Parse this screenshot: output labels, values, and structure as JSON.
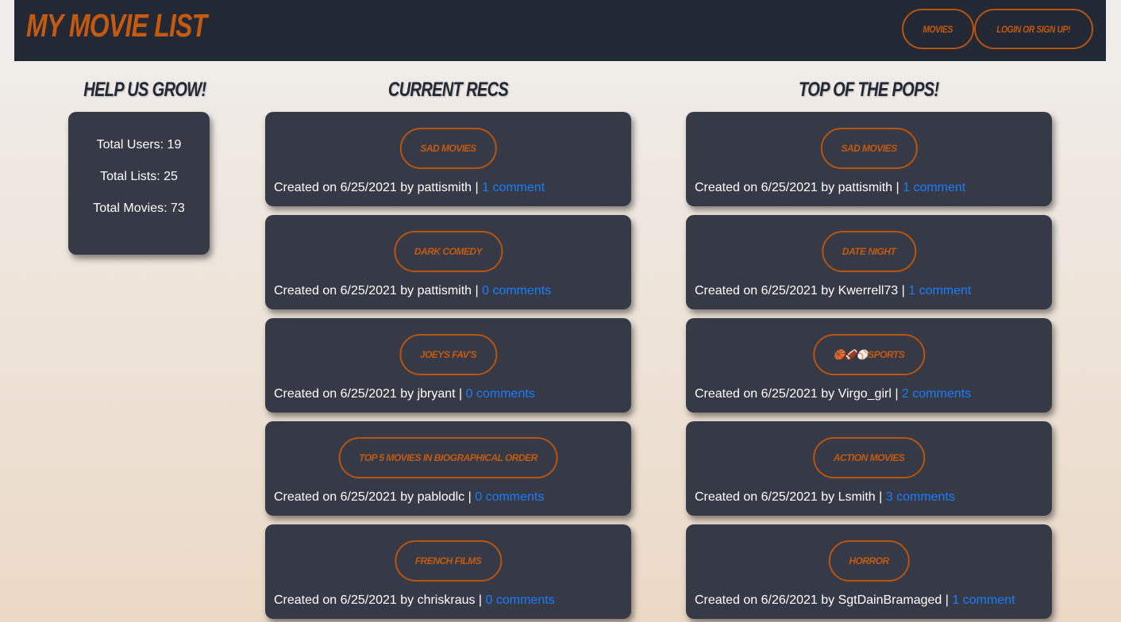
{
  "navbar": {
    "brand": "My Movie List",
    "buttons": [
      {
        "label": "Movies"
      },
      {
        "label": "Login or Sign Up!"
      }
    ]
  },
  "stats": {
    "heading": "Help Us Grow!",
    "lines": [
      "Total Users: 19",
      "Total Lists: 25",
      "Total Movies: 73"
    ]
  },
  "current_recs": {
    "heading": "Current Recs",
    "lists": [
      {
        "title": "Sad Movies",
        "meta": "Created on 6/25/2021 by pattismith | ",
        "comments": "1 comment"
      },
      {
        "title": "Dark Comedy",
        "meta": "Created on 6/25/2021 by pattismith | ",
        "comments": "0 comments"
      },
      {
        "title": "Joeys Fav's",
        "meta": "Created on 6/25/2021 by jbryant | ",
        "comments": "0 comments"
      },
      {
        "title": "Top 5 movies in biographical order",
        "meta": "Created on 6/25/2021 by pablodlc | ",
        "comments": "0 comments"
      },
      {
        "title": "French Films",
        "meta": "Created on 6/25/2021 by chriskraus | ",
        "comments": "0 comments"
      }
    ]
  },
  "top_pops": {
    "heading": "Top of the Pops!",
    "lists": [
      {
        "title": "Sad Movies",
        "meta": "Created on 6/25/2021 by pattismith | ",
        "comments": "1 comment"
      },
      {
        "title": "Date Night",
        "meta": "Created on 6/25/2021 by Kwerrell73 | ",
        "comments": "1 comment"
      },
      {
        "title": "🏀🏈⚾Sports",
        "meta": "Created on 6/25/2021 by Virgo_girl | ",
        "comments": "2 comments"
      },
      {
        "title": "Action Movies",
        "meta": "Created on 6/25/2021 by Lsmith | ",
        "comments": "3 comments"
      },
      {
        "title": "Horror",
        "meta": "Created on 6/26/2021 by SgtDainBramaged | ",
        "comments": "1 comment"
      }
    ]
  },
  "colors": {
    "accent": "#c45a10",
    "navbar_bg": "#222834",
    "card_bg": "#353a46",
    "link": "#1a7cff"
  }
}
